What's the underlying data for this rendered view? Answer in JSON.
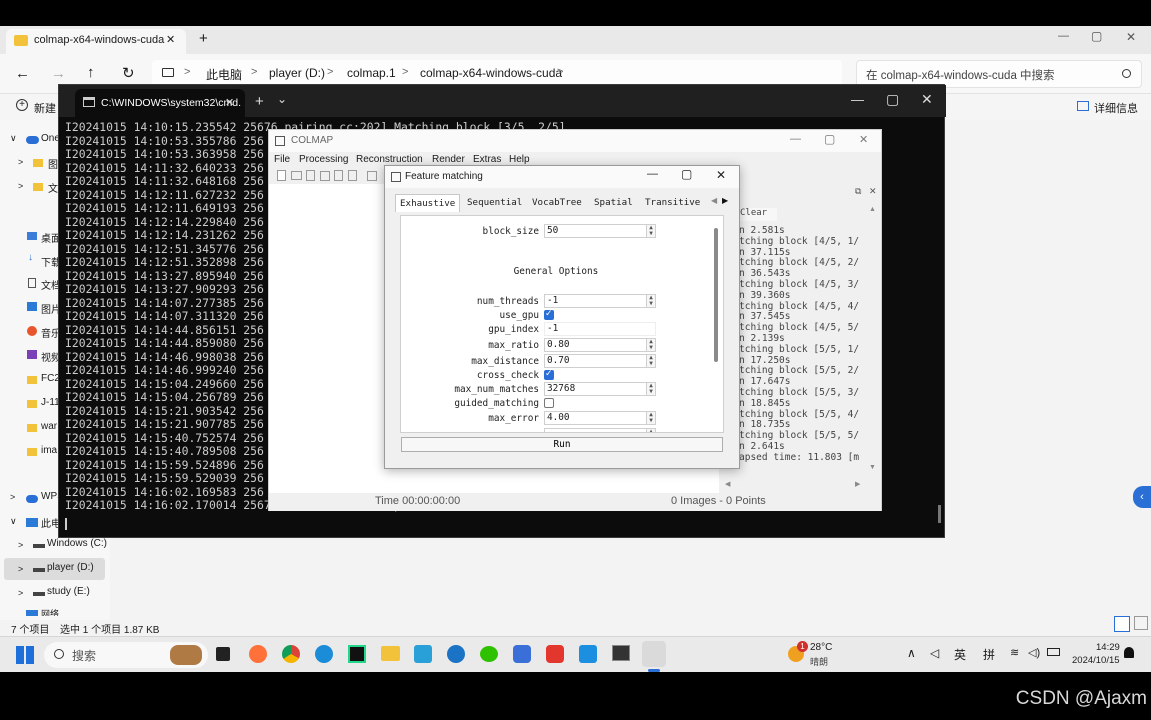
{
  "explorer": {
    "tab_title": "colmap-x64-windows-cuda",
    "tab_close": "✕",
    "new_tab": "+",
    "window_controls": [
      "—",
      "▢",
      "✕"
    ],
    "nav_buttons": [
      "←",
      "→",
      "↑",
      "↻"
    ],
    "breadcrumb": [
      "此电脑",
      "player (D:)",
      "colmap.1",
      "colmap-x64-windows-cuda"
    ],
    "breadcrumb_sep": ">",
    "search_placeholder": "在 colmap-x64-windows-cuda 中搜索",
    "new_button": "新建",
    "details_button": "详细信息",
    "sidebar_items": [
      "One",
      "图",
      "文",
      "桌面",
      "下载",
      "文档",
      "图片",
      "音乐",
      "视频",
      "FC2",
      "J-11",
      "war",
      "ima",
      "WPS",
      "此电",
      "Windows (C:)",
      "player (D:)",
      "study (E:)",
      "网络"
    ],
    "status_items": "7 个项目",
    "status_selected": "选中 1 个项目  1.87 KB"
  },
  "cmd": {
    "tab_title": "C:\\WINDOWS\\system32\\cmd.",
    "tab_close": "✕",
    "new_tab": "+",
    "dropdown": "⌄",
    "window_controls": [
      "—",
      "▢",
      "✕"
    ],
    "lines": [
      "I20241015 14:10:15.235542 25676 pairing.cc:202] Matching block [3/5, 2/5]",
      "I20241015 14:10:53.355786 256",
      "I20241015 14:10:53.363958 256",
      "I20241015 14:11:32.640233 256",
      "I20241015 14:11:32.648168 256",
      "I20241015 14:12:11.627232 256",
      "I20241015 14:12:11.649193 256",
      "I20241015 14:12:14.229840 256",
      "I20241015 14:12:14.231262 256",
      "I20241015 14:12:51.345776 256",
      "I20241015 14:12:51.352898 256",
      "I20241015 14:13:27.895940 256",
      "I20241015 14:13:27.909293 256",
      "I20241015 14:14:07.277385 256",
      "I20241015 14:14:07.311320 256",
      "I20241015 14:14:44.856151 256",
      "I20241015 14:14:44.859080 256",
      "I20241015 14:14:46.998038 256",
      "I20241015 14:14:46.999240 256",
      "I20241015 14:15:04.249660 256",
      "I20241015 14:15:04.256789 256",
      "I20241015 14:15:21.903542 256",
      "I20241015 14:15:21.907785 256",
      "I20241015 14:15:40.752574 256",
      "I20241015 14:15:40.789508 256",
      "I20241015 14:15:59.524896 256",
      "I20241015 14:15:59.529039 256",
      "I20241015 14:16:02.169583 256",
      "I20241015 14:16:02.170014 25676 timer.cc:91] Elapsed time: 11.803 [minutes]"
    ]
  },
  "colmap": {
    "title": "COLMAP",
    "window_controls": [
      "—",
      "▢",
      "✕"
    ],
    "menu": [
      "File",
      "Processing",
      "Reconstruction",
      "Render",
      "Extras",
      "Help"
    ],
    "log_clear": "Clear",
    "log_lines": [
      "n 2.581s",
      "tching block [4/5, 1/",
      "n 37.115s",
      "tching block [4/5, 2/",
      "n 36.543s",
      "tching block [4/5, 3/",
      "n 39.360s",
      "tching block [4/5, 4/",
      "n 37.545s",
      "tching block [4/5, 5/",
      "n 2.139s",
      "tching block [5/5, 1/",
      "n 17.250s",
      "tching block [5/5, 2/",
      "n 17.647s",
      "tching block [5/5, 3/",
      "n 18.845s",
      "tching block [5/5, 4/",
      "n 18.735s",
      "tching block [5/5, 5/",
      "n 2.641s",
      "apsed time: 11.803 [m"
    ],
    "status_time": "Time 00:00:00:00",
    "status_images": "0 Images - 0 Points"
  },
  "feature_matching": {
    "title": "Feature matching",
    "window_controls": [
      "—",
      "▢",
      "✕"
    ],
    "tabs": [
      "Exhaustive",
      "Sequential",
      "VocabTree",
      "Spatial",
      "Transitive"
    ],
    "active_tab": "Exhaustive",
    "block_size_label": "block_size",
    "block_size_value": "50",
    "section_title": "General Options",
    "options": [
      {
        "label": "num_threads",
        "value": "-1",
        "type": "spin"
      },
      {
        "label": "use_gpu",
        "checked": true,
        "type": "check"
      },
      {
        "label": "gpu_index",
        "value": "-1",
        "type": "text"
      },
      {
        "label": "max_ratio",
        "value": "0.80",
        "type": "spin"
      },
      {
        "label": "max_distance",
        "value": "0.70",
        "type": "spin"
      },
      {
        "label": "cross_check",
        "checked": true,
        "type": "check"
      },
      {
        "label": "max_num_matches",
        "value": "32768",
        "type": "spin"
      },
      {
        "label": "guided_matching",
        "checked": false,
        "type": "check"
      },
      {
        "label": "max_error",
        "value": "4.00",
        "type": "spin"
      }
    ],
    "run_button": "Run"
  },
  "taskbar": {
    "search_placeholder": "搜索",
    "weather_temp": "28°C",
    "weather_desc": "晴朗",
    "weather_badge": "1",
    "ime_lang": "英",
    "ime_mode": "拼",
    "time": "14:29",
    "date": "2024/10/15"
  },
  "watermark": "CSDN @Ajaxm",
  "colors": {
    "accent": "#2a6fd6",
    "cmd_bg": "#0c0c0c",
    "cmd_text": "#cccccc"
  }
}
